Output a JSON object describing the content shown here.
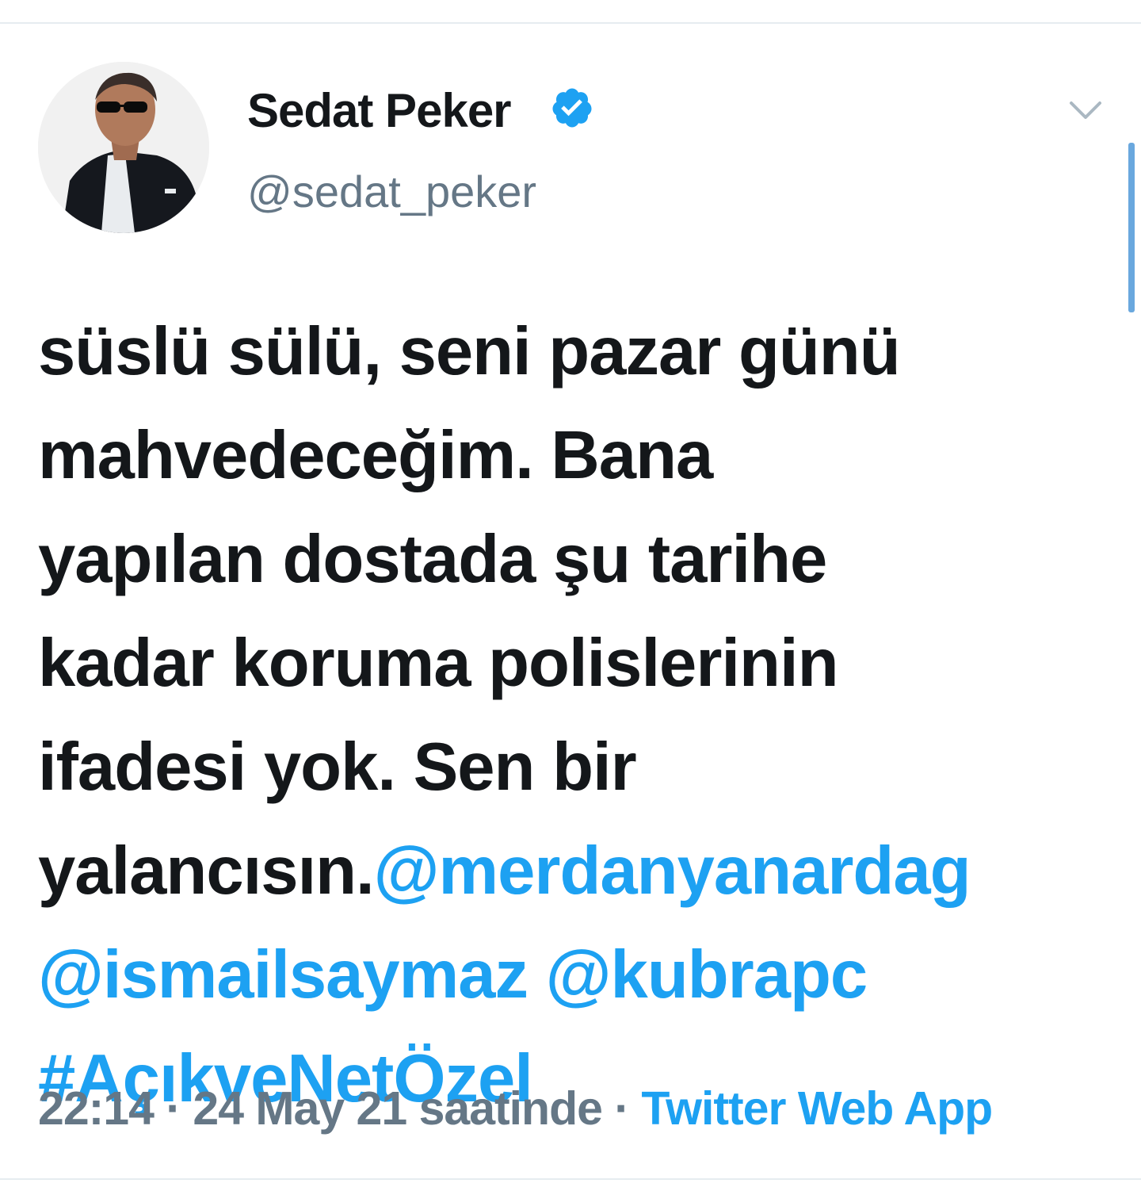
{
  "author": {
    "display_name": "Sedat Peker",
    "handle": "@sedat_peker",
    "verified": true,
    "avatar_icon": "profile-photo"
  },
  "tweet": {
    "text_lines": [
      "süslü sülü, seni pazar günü",
      "mahvedeceğim. Bana",
      "yapılan dostada şu tarihe",
      "kadar koruma polislerinin",
      "ifadesi yok. Sen bir",
      "yalancısın."
    ],
    "mentions": [
      "@merdanyanardag",
      "@ismailsaymaz",
      "@kubrapc"
    ],
    "hashtag": "#AçıkveNetÖzel"
  },
  "meta": {
    "time": "22:14",
    "separator": "·",
    "date": "24 May 21 saatinde",
    "source": "Twitter Web App"
  },
  "colors": {
    "link": "#1da1f2",
    "muted": "#657786",
    "text": "#14171a",
    "verified": "#1da1f2"
  }
}
